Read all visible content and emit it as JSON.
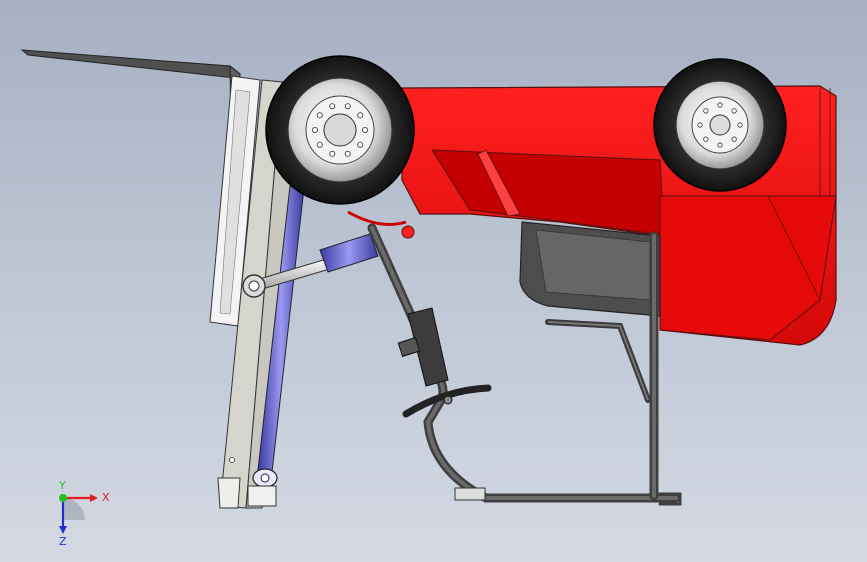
{
  "viewport": {
    "background_top": "#a6b0c2",
    "background_bottom": "#d4d9e3"
  },
  "model": {
    "body_color": "#ff1010",
    "frame_color": "#4a4a4a",
    "mast_color": "#d8d8d0",
    "cylinder_color": "#6a6ad8"
  },
  "triad": {
    "x_label": "X",
    "y_label": "Y",
    "z_label": "Z",
    "x_color": "#e02020",
    "y_color": "#20c020",
    "z_color": "#2030d0"
  }
}
